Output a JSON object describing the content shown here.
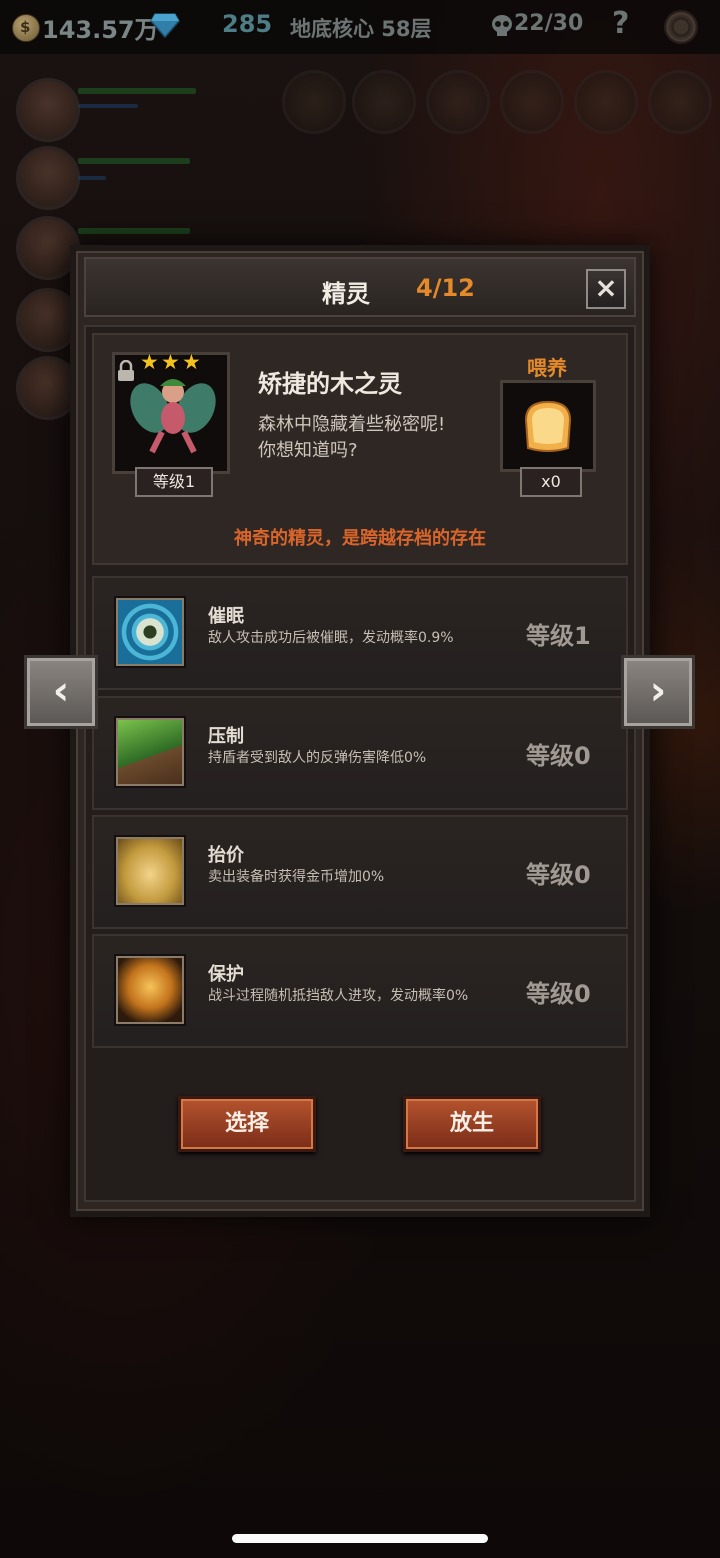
{
  "topbar": {
    "gold": "143.57万",
    "gems": "285",
    "floor": "地底核心 58层",
    "souls": "22/30",
    "help": "?"
  },
  "dialog": {
    "title": "精灵",
    "count": "4/12",
    "close": "×"
  },
  "spirit": {
    "stars": 3,
    "level": "等级1",
    "name": "矫捷的木之灵",
    "desc_line1": "森林中隐藏着些秘密呢!",
    "desc_line2": "你想知道吗?",
    "feed_label": "喂养",
    "feed_count": "x0",
    "tagline": "神奇的精灵，是跨越存档的存在"
  },
  "skills": [
    {
      "name": "催眠",
      "desc": "敌人攻击成功后被催眠，发动概率0.9%",
      "level": "等级1",
      "icon": "hypnosis-eye-icon"
    },
    {
      "name": "压制",
      "desc": "持盾者受到敌人的反弹伤害降低0%",
      "level": "等级0",
      "icon": "suppress-claw-icon"
    },
    {
      "name": "抬价",
      "desc": "卖出装备时获得金币增加0%",
      "level": "等级0",
      "icon": "raise-price-hand-icon"
    },
    {
      "name": "保护",
      "desc": "战斗过程随机抵挡敌人进攻，发动概率0%",
      "level": "等级0",
      "icon": "protect-spirit-icon"
    }
  ],
  "nav": {
    "prev": "‹",
    "next": "›"
  },
  "buttons": {
    "select": "选择",
    "release": "放生"
  },
  "colors": {
    "accent_orange": "#e48a2a",
    "tagline": "#d9652a",
    "button": "#b5532e",
    "star": "#f4c21c"
  }
}
